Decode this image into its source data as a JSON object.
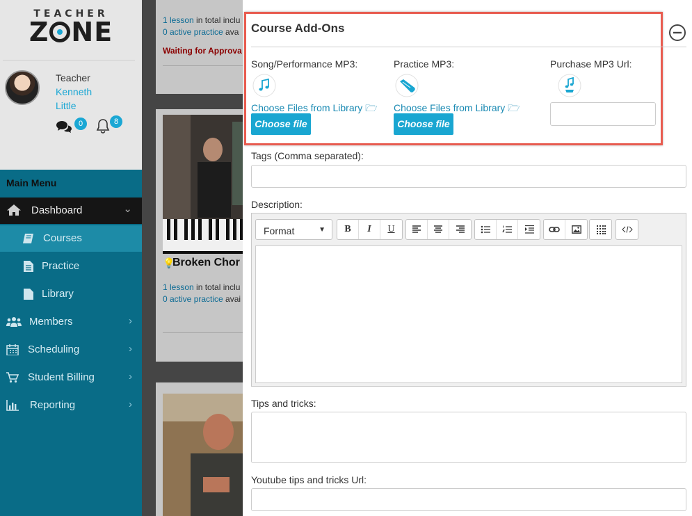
{
  "brand": {
    "logo_top": "TEACHER",
    "logo_main_left": "Z",
    "logo_main_right": "NE"
  },
  "user": {
    "role": "Teacher",
    "first_name": "Kenneth",
    "last_name": "Little",
    "messages_count": "0",
    "notifications_count": "8"
  },
  "menu": {
    "title": "Main Menu",
    "items": [
      {
        "label": "Dashboard",
        "icon": "home-icon",
        "chevron": "⌄"
      },
      {
        "label": "Courses",
        "icon": "book-icon"
      },
      {
        "label": "Practice",
        "icon": "file-text-icon"
      },
      {
        "label": "Library",
        "icon": "file-icon"
      },
      {
        "label": "Members",
        "icon": "users-icon",
        "chevron": "›"
      },
      {
        "label": "Scheduling",
        "icon": "calendar-icon",
        "chevron": "›"
      },
      {
        "label": "Student Billing",
        "icon": "cart-icon",
        "chevron": "›"
      },
      {
        "label": "Reporting",
        "icon": "bar-chart-icon",
        "chevron": "›"
      }
    ]
  },
  "courses_list": {
    "card1": {
      "lessons_link": "1 lesson",
      "lessons_rest": " in total inclu",
      "practice_link": "0 active practice",
      "practice_rest": " ava",
      "status": "Waiting for Approva"
    },
    "card2": {
      "title": "Broken Chor",
      "lessons_link": "1 lesson",
      "lessons_rest": " in total inclu",
      "practice_link": "0 active practice",
      "practice_rest": " avai"
    }
  },
  "form": {
    "addons_title": "Course Add-Ons",
    "song_label": "Song/Performance MP3:",
    "practice_label": "Practice MP3:",
    "purchase_label": "Purchase MP3 Url:",
    "choose_library": "Choose Files from Library",
    "choose_file": "Choose file",
    "purchase_url_value": "",
    "tags_label": "Tags (Comma separated):",
    "tags_value": "",
    "description_label": "Description:",
    "format_label": "Format",
    "bold": "B",
    "italic": "I",
    "underline": "U",
    "tips_label": "Tips and tricks:",
    "tips_value": "",
    "youtube_label": "Youtube tips and tricks Url:",
    "youtube_value": ""
  },
  "colors": {
    "accent": "#1aa7d4",
    "menu_bg": "#096c87",
    "menu_active": "#1d8ba7",
    "highlight_border": "#e85c50",
    "warning": "#8a0000"
  }
}
